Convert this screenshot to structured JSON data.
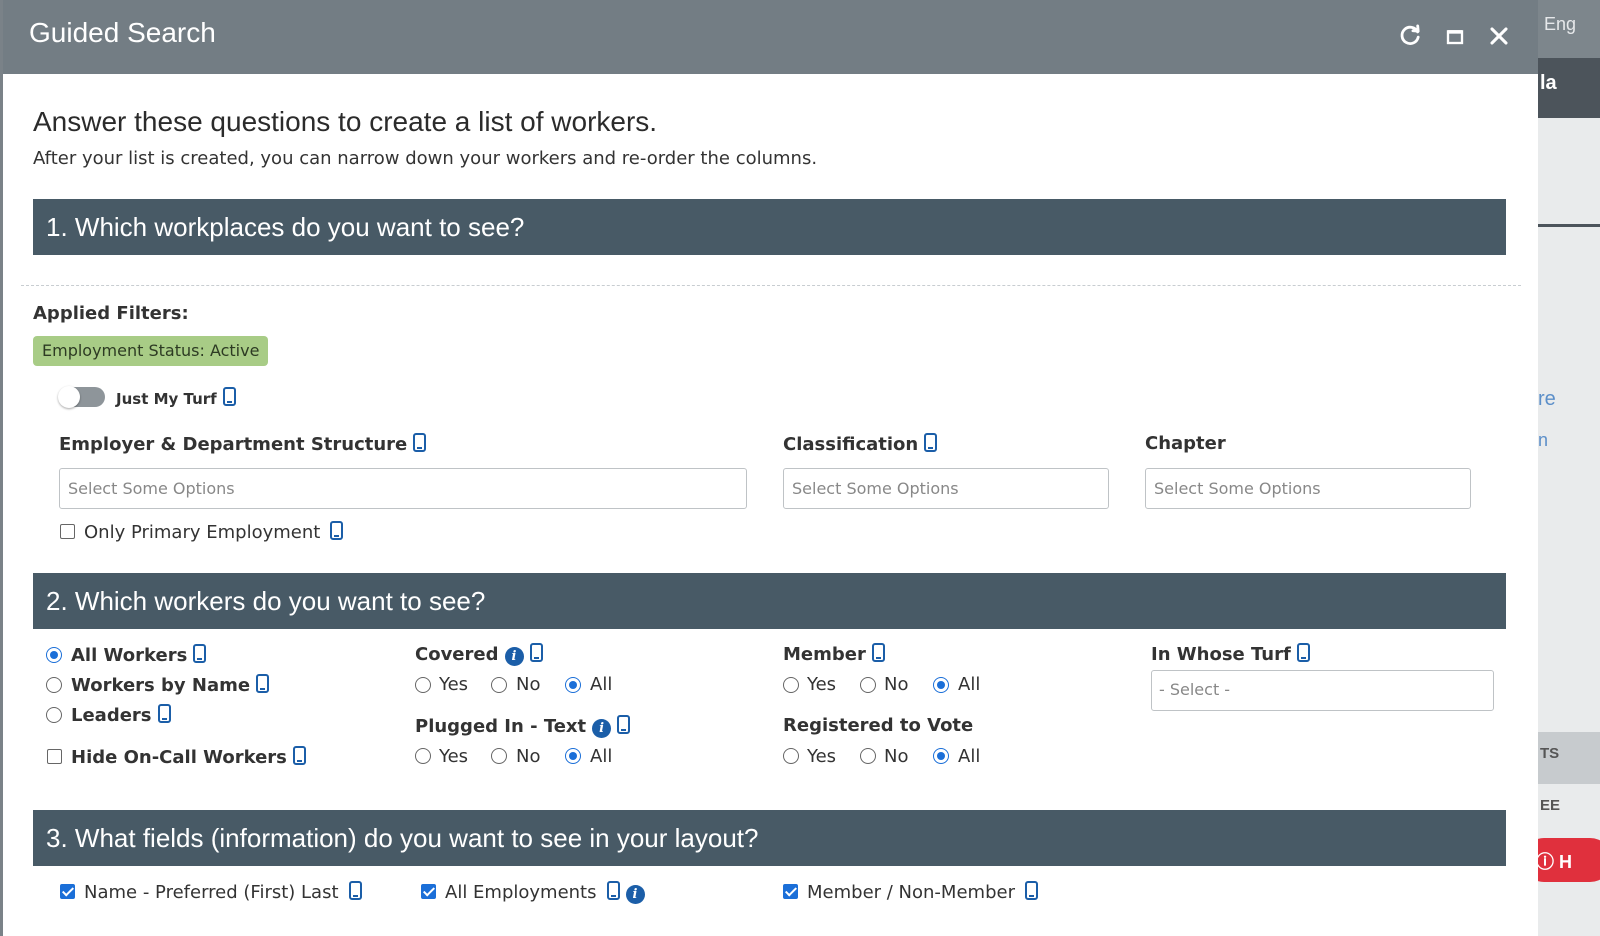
{
  "background_app": {
    "top_text": "Eng",
    "dark_text": "la",
    "link_text": "re",
    "link_text2": "n",
    "strip_text_1": "TS",
    "strip_text_2": "EE",
    "help_text": "H"
  },
  "modal": {
    "title": "Guided Search",
    "header_icons": [
      "refresh-icon",
      "maximize-icon",
      "close-icon"
    ]
  },
  "intro": {
    "title": "Answer these questions to create a list of workers.",
    "subtitle": "After your list is created, you can narrow down your workers and re-order the columns."
  },
  "section1": {
    "title": "1. Which workplaces do you want to see?",
    "applied_filters_label": "Applied Filters:",
    "filter_chip": "Employment Status: Active",
    "toggle_label": "Just My Turf",
    "toggle_on": false,
    "employer_label": "Employer & Department Structure",
    "employer_placeholder": "Select Some Options",
    "classification_label": "Classification",
    "classification_placeholder": "Select Some Options",
    "chapter_label": "Chapter",
    "chapter_placeholder": "Select Some Options",
    "primary_employment_label": "Only Primary Employment",
    "primary_employment_checked": false
  },
  "section2": {
    "title": "2. Which workers do you want to see?",
    "worker_options": [
      {
        "label": "All Workers",
        "selected": true
      },
      {
        "label": "Workers by Name",
        "selected": false
      },
      {
        "label": "Leaders",
        "selected": false
      }
    ],
    "hide_oncall_label": "Hide On-Call Workers",
    "hide_oncall_checked": false,
    "yes_label": "Yes",
    "no_label": "No",
    "all_label": "All",
    "covered_label": "Covered",
    "covered_value": "All",
    "plugged_label": "Plugged In - Text",
    "plugged_value": "All",
    "member_label": "Member",
    "member_value": "All",
    "registered_label": "Registered to Vote",
    "registered_value": "All",
    "turf_label": "In Whose Turf",
    "turf_select": "- Select -"
  },
  "section3": {
    "title": "3. What fields (information) do you want to see in your layout?",
    "fields": [
      {
        "label": "Name - Preferred (First) Last",
        "checked": true
      },
      {
        "label": "All Employments",
        "checked": true
      },
      {
        "label": "Member / Non-Member",
        "checked": true
      }
    ]
  }
}
